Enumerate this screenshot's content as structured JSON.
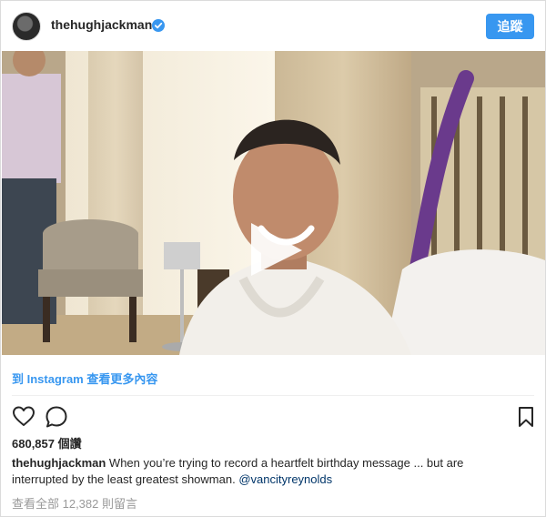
{
  "colors": {
    "accent": "#3897f0",
    "text": "#262626",
    "muted": "#999999",
    "mention": "#003569"
  },
  "header": {
    "username": "thehughjackman",
    "verified_icon": "verified-badge-icon",
    "follow_label": "追蹤"
  },
  "media": {
    "type": "video",
    "play_icon": "play-icon"
  },
  "link": {
    "view_more": "到 Instagram 查看更多內容"
  },
  "actions": {
    "like_icon": "heart-icon",
    "comment_icon": "comment-icon",
    "save_icon": "bookmark-icon"
  },
  "stats": {
    "views": "680,857 個讚"
  },
  "caption": {
    "username": "thehughjackman",
    "text": "When you’re trying to record a heartfelt birthday message ... but are interrupted by the least greatest showman.",
    "mention": "@vancityreynolds"
  },
  "comments": {
    "view_all": "查看全部 12,382 則留言"
  }
}
